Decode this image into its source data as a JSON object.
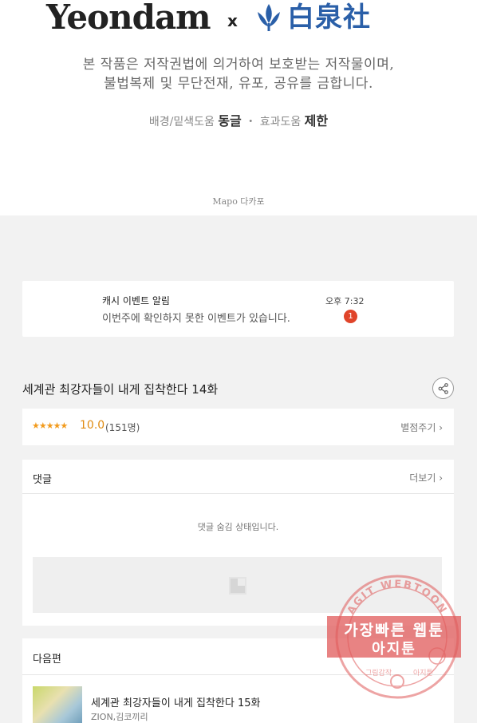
{
  "credits": {
    "brand_left": "Yeondam",
    "separator": "x",
    "brand_right": "白泉社",
    "notice_line1": "본 작품은 저작권법에 의거하여 보호받는 저작물이며,",
    "notice_line2": "불법복제 및 무단전재, 유포, 공유를 금합니다.",
    "staff_bg_label": "배경/밑색도움",
    "staff_bg_name": "동글",
    "staff_dot": "・",
    "staff_fx_label": "효과도움",
    "staff_fx_name": "제한",
    "studio": "Mapo 다카포"
  },
  "notification": {
    "title": "캐시 이벤트 알림",
    "message": "이번주에 확인하지 못한 이벤트가 있습니다.",
    "time": "오후 7:32",
    "badge": "1"
  },
  "episode": {
    "title": "세계관 최강자들이 내게 집착한다 14화"
  },
  "rating": {
    "stars": "★★★★★",
    "score": "10.0",
    "count": "(151명)",
    "rate_link": "별점주기 ›"
  },
  "comments": {
    "label": "댓글",
    "more_link": "더보기 ›",
    "hidden_message": "댓글 숨김 상태입니다."
  },
  "next_episode": {
    "label": "다음편",
    "title": "세계관 최강자들이 내게 집착한다 15화",
    "author": "ZION,김코끼리"
  },
  "watermark": {
    "ring_text": "AGIT WEBTOON",
    "line1": "가장빠른 웹툰",
    "line2": "아지툰",
    "bottom_left": "그림감작",
    "bottom_right": "아지툰"
  },
  "colors": {
    "accent": "#f29b1d",
    "badge": "#e0442a",
    "brand_blue": "#2a5fa8",
    "stamp_red": "#e05a5a"
  }
}
